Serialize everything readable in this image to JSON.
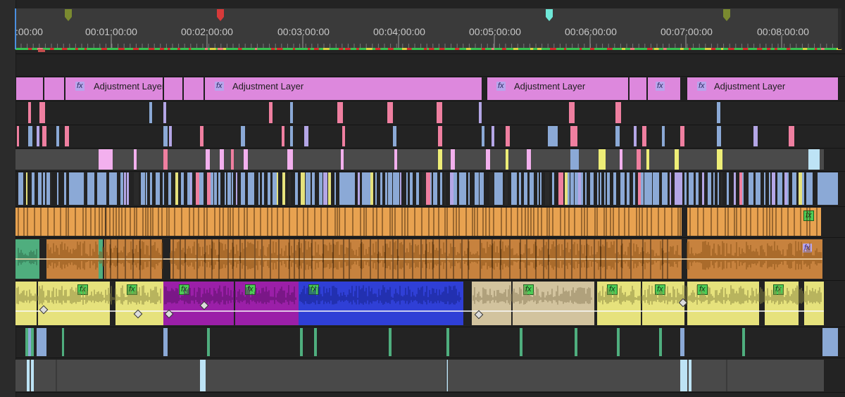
{
  "ruler": {
    "timecodes": [
      ":00:00",
      "00:01:00:00",
      "00:02:00:00",
      "00:03:00:00",
      "00:04:00:00",
      "00:05:00:00",
      "00:06:00:00",
      "00:07:00:00",
      "00:08:00:00"
    ],
    "markers": [
      {
        "name": "marker-olive-1",
        "color": "#7a8a30"
      },
      {
        "name": "marker-red",
        "color": "#d63a3a"
      },
      {
        "name": "marker-cyan",
        "color": "#6fe8d8"
      },
      {
        "name": "marker-olive-2",
        "color": "#7a8a30"
      }
    ]
  },
  "adjustment_layers": [
    {
      "label": "Adjustment Layer",
      "fx": "fx"
    },
    {
      "label": "",
      "fx": ""
    },
    {
      "label": "Adjustment Layer",
      "fx": "fx"
    },
    {
      "label": "Adjustment Layer",
      "fx": "fx"
    },
    {
      "label": "",
      "fx": "fx"
    },
    {
      "label": "Adjustment Layer",
      "fx": "fx"
    }
  ],
  "audio_fx_badges": [
    "fx",
    "fx",
    "fx",
    "fx",
    "fx",
    "fx",
    "fx",
    "fx",
    "fx",
    "fx",
    "fx",
    "fx",
    "fx"
  ],
  "colors": {
    "adjustment": "#dd88dd",
    "music": "#e8a250",
    "dialogue_yellow": "#e6e27c",
    "purple": "#9b1fa8",
    "blue": "#2f3fd6",
    "tan": "#d2c39e",
    "pink": "#ef7fa0",
    "light_blue": "#8ba9d6",
    "lavender": "#b4a6e6",
    "playhead": "#4a8fe0"
  }
}
